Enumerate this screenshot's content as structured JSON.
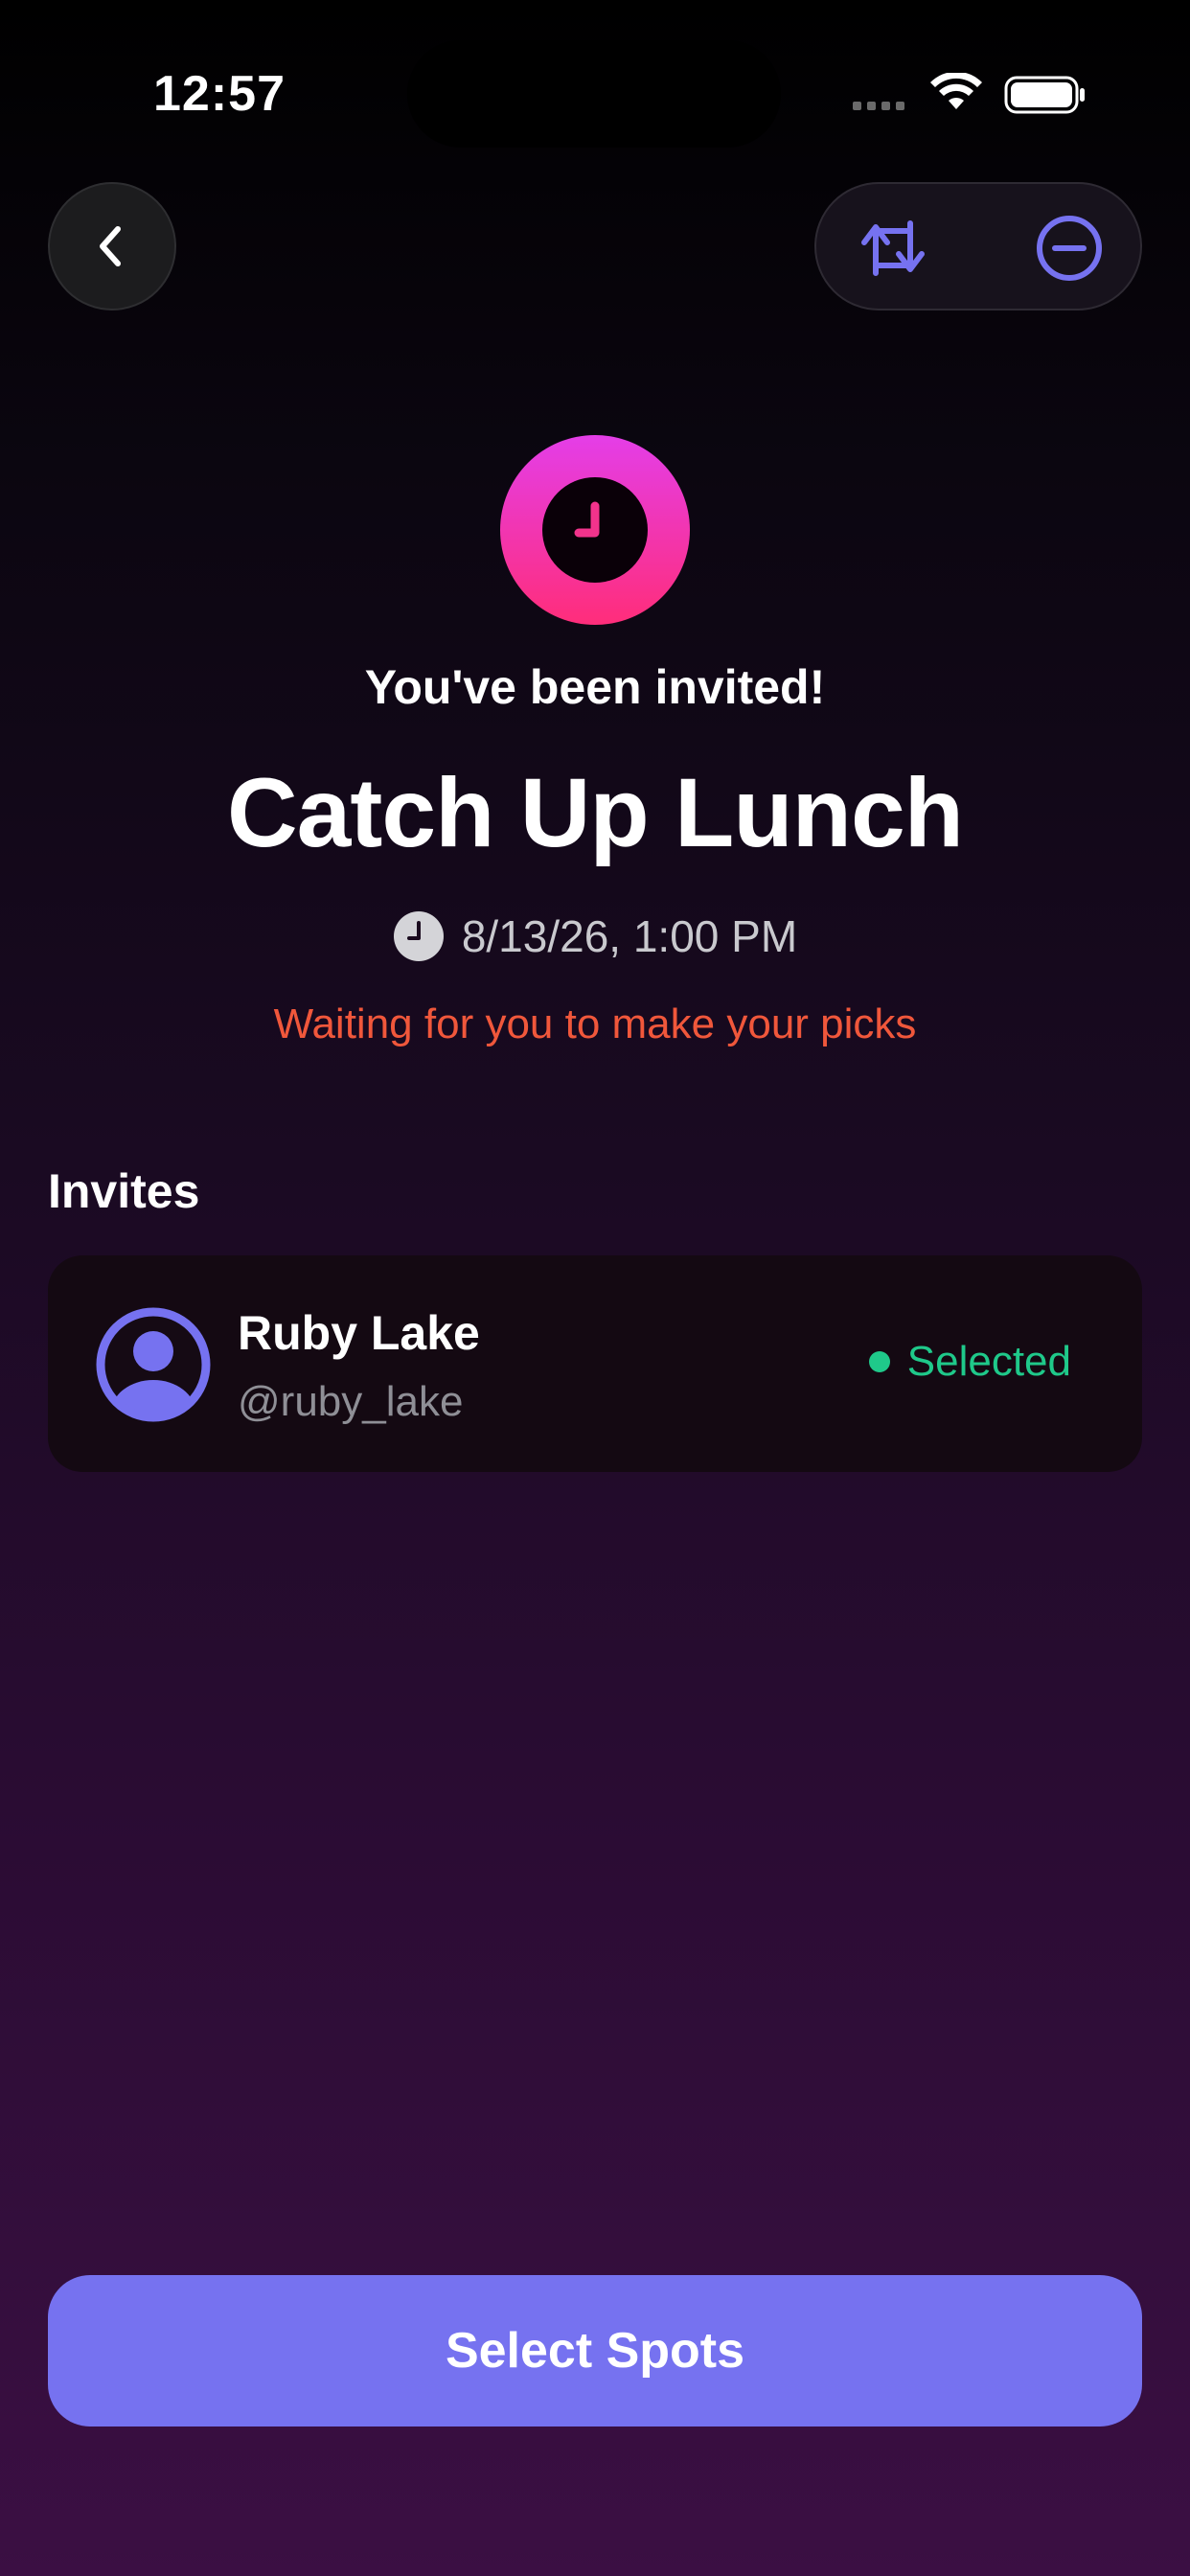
{
  "status_bar": {
    "time": "12:57"
  },
  "header": {
    "back_icon": "chevron-left-icon",
    "actions": [
      {
        "icon": "swap-arrows-icon"
      },
      {
        "icon": "minus-circle-icon"
      }
    ]
  },
  "event": {
    "icon": "clock-icon",
    "invited_text": "You've been invited!",
    "title": "Catch Up Lunch",
    "datetime": "8/13/26, 1:00 PM",
    "status": "Waiting for you to make your picks"
  },
  "invites": {
    "heading": "Invites",
    "items": [
      {
        "name": "Ruby Lake",
        "handle": "@ruby_lake",
        "status": "Selected"
      }
    ]
  },
  "primary_action": {
    "label": "Select Spots"
  },
  "colors": {
    "accent": "#7672f0",
    "status_warning": "#f0573b",
    "status_selected": "#1fc98a",
    "icon_gradient_top": "#e43ee8",
    "icon_gradient_bottom": "#ff2d7a"
  }
}
